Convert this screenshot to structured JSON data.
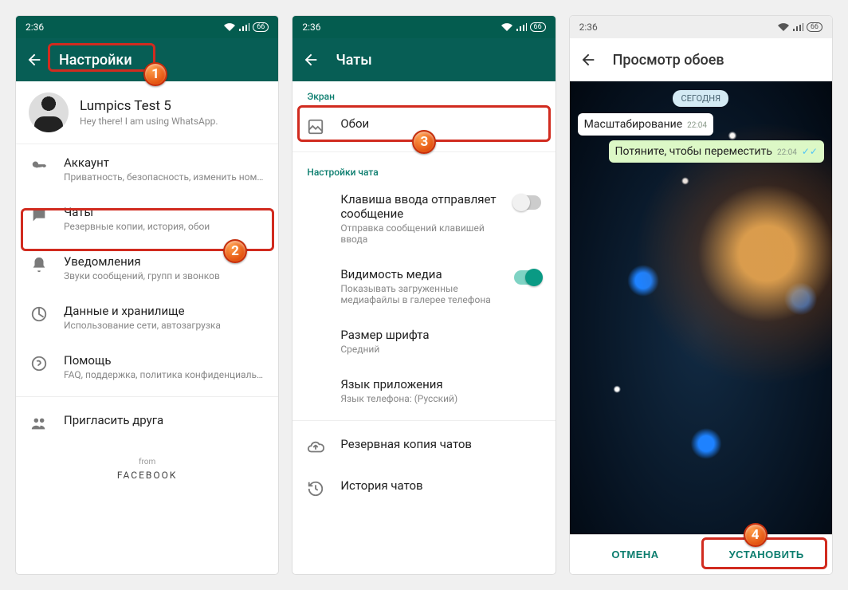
{
  "status": {
    "time": "2:36",
    "battery": "66"
  },
  "screen1": {
    "title": "Настройки",
    "profile": {
      "name": "Lumpics Test 5",
      "status": "Hey there! I am using WhatsApp."
    },
    "items": [
      {
        "icon": "key",
        "title": "Аккаунт",
        "sub": "Приватность, безопасность, изменить номер"
      },
      {
        "icon": "chat",
        "title": "Чаты",
        "sub": "Резервные копии, история, обои"
      },
      {
        "icon": "bell",
        "title": "Уведомления",
        "sub": "Звуки сообщений, групп и звонков"
      },
      {
        "icon": "data",
        "title": "Данные и хранилище",
        "sub": "Использование сети, автозагрузка"
      },
      {
        "icon": "help",
        "title": "Помощь",
        "sub": "FAQ, поддержка, политика конфиденциальн..."
      },
      {
        "icon": "invite",
        "title": "Пригласить друга",
        "sub": ""
      }
    ],
    "footer": {
      "from": "from",
      "brand": "FACEBOOK"
    }
  },
  "screen2": {
    "title": "Чаты",
    "section_display": "Экран",
    "wallpaper": "Обои",
    "section_chat": "Настройки чата",
    "enter_send": {
      "title": "Клавиша ввода отправляет сообщение",
      "sub": "Отправка сообщений клавишей ввода"
    },
    "media_vis": {
      "title": "Видимость медиа",
      "sub": "Показывать загруженные медиафайлы в галерее телефона"
    },
    "font_size": {
      "title": "Размер шрифта",
      "sub": "Средний"
    },
    "lang": {
      "title": "Язык приложения",
      "sub": "Язык телефона: (Русский)"
    },
    "backup": "Резервная копия чатов",
    "history": "История чатов"
  },
  "screen3": {
    "title": "Просмотр обоев",
    "today": "СЕГОДНЯ",
    "msg_in": {
      "text": "Масштабирование",
      "time": "22:04"
    },
    "msg_out": {
      "text": "Потяните, чтобы переместить",
      "time": "22:04"
    },
    "cancel": "ОТМЕНА",
    "set": "УСТАНОВИТЬ"
  },
  "annotations": {
    "b1": "1",
    "b2": "2",
    "b3": "3",
    "b4": "4"
  }
}
